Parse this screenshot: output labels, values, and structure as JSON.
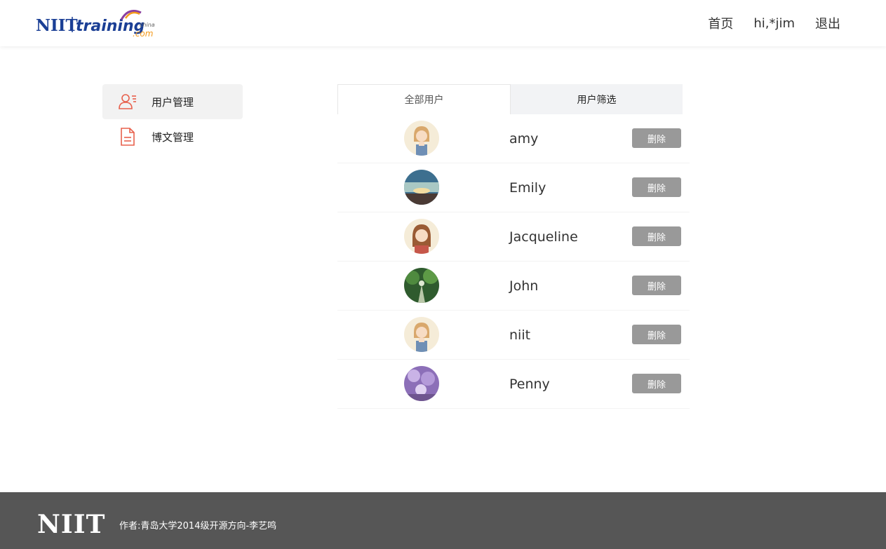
{
  "header": {
    "logo": {
      "brand": "NIIT",
      "word": "training",
      "suffix": ".com",
      "small": "china"
    },
    "nav": {
      "home": "首页",
      "greeting": "hi,*jim",
      "logout": "退出"
    }
  },
  "sidebar": {
    "items": [
      {
        "label": "用户管理",
        "icon": "user-list-icon",
        "active": true
      },
      {
        "label": "博文管理",
        "icon": "document-icon",
        "active": false
      }
    ]
  },
  "main": {
    "tabs": [
      {
        "label": "全部用户",
        "active": true
      },
      {
        "label": "用户筛选",
        "active": false
      }
    ],
    "users": [
      {
        "name": "amy",
        "avatar": "cartoon-girl-avatar",
        "delete_label": "删除"
      },
      {
        "name": "Emily",
        "avatar": "sunset-sky-avatar",
        "delete_label": "删除"
      },
      {
        "name": "Jacqueline",
        "avatar": "cartoon-woman-avatar",
        "delete_label": "删除"
      },
      {
        "name": "John",
        "avatar": "forest-path-avatar",
        "delete_label": "删除"
      },
      {
        "name": "niit",
        "avatar": "cartoon-girl-avatar",
        "delete_label": "删除"
      },
      {
        "name": "Penny",
        "avatar": "purple-blossom-avatar",
        "delete_label": "删除"
      }
    ]
  },
  "footer": {
    "logo": "NIIT",
    "text": "作者:青岛大学2014级开源方向-李艺鸣"
  },
  "colors": {
    "accent_icon": "#e8604c",
    "brand_blue": "#1b3f95",
    "brand_orange": "#f39a1c",
    "delete_button": "#999999",
    "footer_bg": "#565656"
  }
}
